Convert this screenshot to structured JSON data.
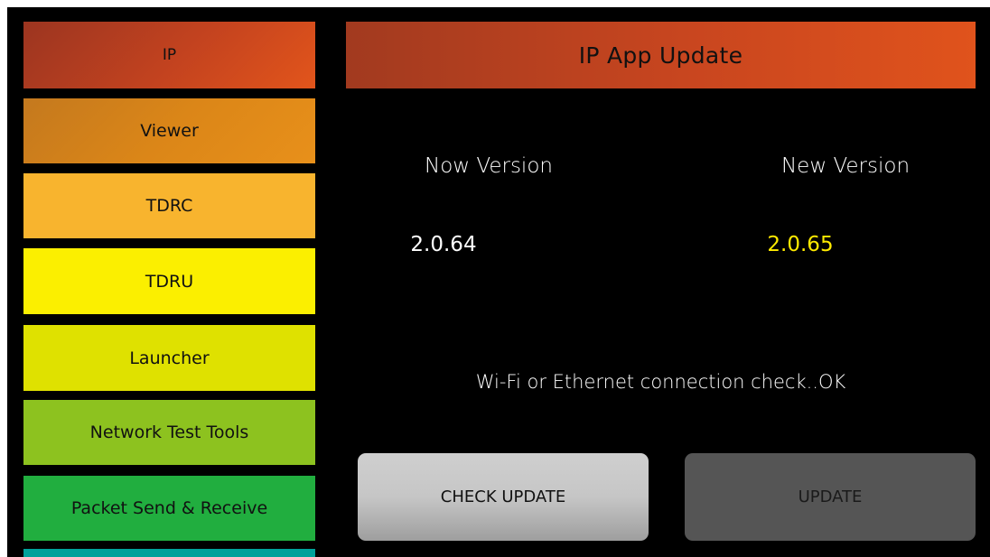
{
  "sidebar": {
    "items": [
      {
        "label": "IP",
        "color": "#c64420"
      },
      {
        "label": "Viewer",
        "color": "#d98319"
      },
      {
        "label": "TDRC",
        "color": "#f9b52c"
      },
      {
        "label": "TDRU",
        "color": "#fbef00"
      },
      {
        "label": "Launcher",
        "color": "#dfe100"
      },
      {
        "label": "Network Test Tools",
        "color": "#8dc21f"
      },
      {
        "label": "Packet Send & Receive",
        "color": "#21ae3f"
      },
      {
        "label": "",
        "color": "#00a19a"
      }
    ]
  },
  "header": {
    "title": "IP App Update",
    "color": "#c9461f"
  },
  "versions": {
    "now_label": "Now Version",
    "new_label": "New Version",
    "now_value": "2.0.64",
    "new_value": "2.0.65",
    "now_color": "#ffffff",
    "new_color": "#ffea00"
  },
  "status": {
    "text": "Wi-Fi or Ethernet connection check..OK"
  },
  "actions": {
    "check_update_label": "CHECK UPDATE",
    "update_label": "UPDATE"
  }
}
